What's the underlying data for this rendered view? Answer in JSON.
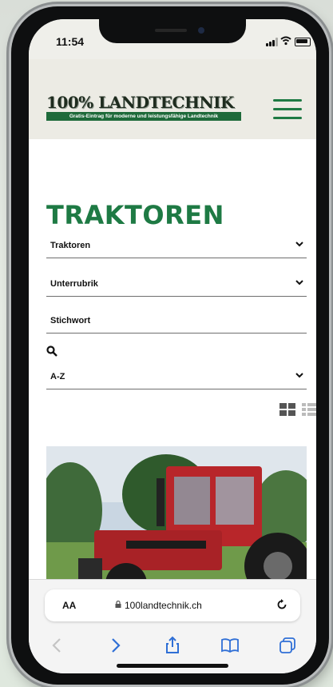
{
  "status": {
    "time": "11:54"
  },
  "header": {
    "logo_title": "100% LANDTECHNIK",
    "logo_sub": "Gratis-Eintrag für moderne und leistungsfähige Landtechnik"
  },
  "page": {
    "title": "TRAKTOREN",
    "category_select": "Traktoren",
    "subcategory_select": "Unterrubrik",
    "keyword_placeholder": "Stichwort",
    "sort_select": "A-Z"
  },
  "browser": {
    "text_size": "AA",
    "url": "100landtechnik.ch"
  },
  "colors": {
    "brand_green": "#1e7a44",
    "tractor_red": "#b8262a"
  }
}
